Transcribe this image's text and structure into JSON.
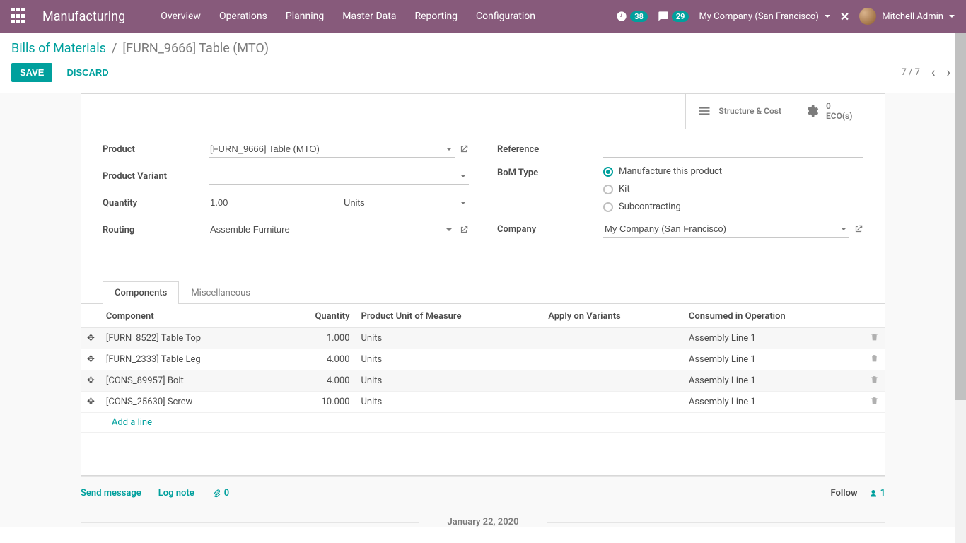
{
  "nav": {
    "brand": "Manufacturing",
    "menu": [
      "Overview",
      "Operations",
      "Planning",
      "Master Data",
      "Reporting",
      "Configuration"
    ],
    "badge1": "38",
    "badge2": "29",
    "company": "My Company (San Francisco)",
    "user": "Mitchell Admin"
  },
  "breadcrumb": {
    "root": "Bills of Materials",
    "current": "[FURN_9666] Table (MTO)"
  },
  "actions": {
    "save": "SAVE",
    "discard": "DISCARD"
  },
  "pager": {
    "text": "7 / 7"
  },
  "stats": {
    "structure": "Structure & Cost",
    "ecos_num": "0",
    "ecos_label": "ECO(s)"
  },
  "form": {
    "labels": {
      "product": "Product",
      "variant": "Product Variant",
      "quantity": "Quantity",
      "routing": "Routing",
      "reference": "Reference",
      "bomtype": "BoM Type",
      "company": "Company"
    },
    "product": "[FURN_9666] Table (MTO)",
    "variant": "",
    "quantity": "1.00",
    "qty_unit": "Units",
    "routing": "Assemble Furniture",
    "reference": "",
    "bom_options": [
      "Manufacture this product",
      "Kit",
      "Subcontracting"
    ],
    "bom_selected_index": 0,
    "company": "My Company (San Francisco)"
  },
  "tabs": [
    "Components",
    "Miscellaneous"
  ],
  "table": {
    "headers": [
      "Component",
      "Quantity",
      "Product Unit of Measure",
      "Apply on Variants",
      "Consumed in Operation"
    ],
    "rows": [
      {
        "component": "[FURN_8522] Table Top",
        "qty": "1.000",
        "uom": "Units",
        "variants": "",
        "op": "Assembly Line 1"
      },
      {
        "component": "[FURN_2333] Table Leg",
        "qty": "4.000",
        "uom": "Units",
        "variants": "",
        "op": "Assembly Line 1"
      },
      {
        "component": "[CONS_89957] Bolt",
        "qty": "4.000",
        "uom": "Units",
        "variants": "",
        "op": "Assembly Line 1"
      },
      {
        "component": "[CONS_25630] Screw",
        "qty": "10.000",
        "uom": "Units",
        "variants": "",
        "op": "Assembly Line 1"
      }
    ],
    "add_line": "Add a line"
  },
  "chatter": {
    "send": "Send message",
    "log": "Log note",
    "attach_count": "0",
    "follow": "Follow",
    "follower_count": "1",
    "date": "January 22, 2020"
  }
}
